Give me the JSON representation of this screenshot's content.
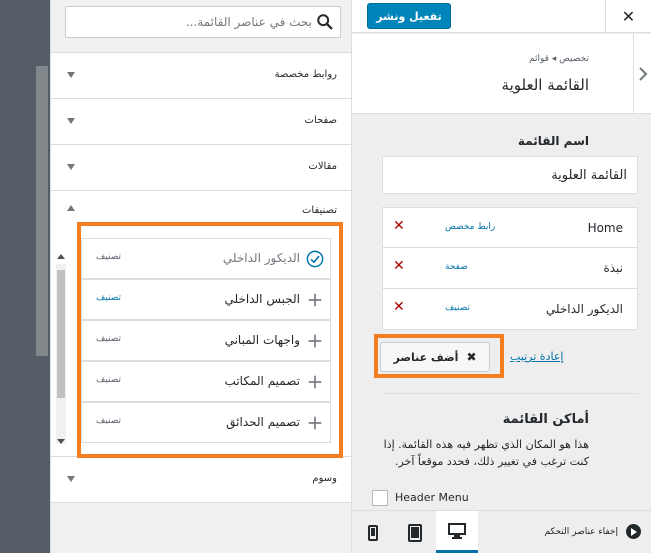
{
  "search": {
    "placeholder": "بحث في عناصر القائمة..."
  },
  "sections": [
    {
      "label": "روابط مخصصة",
      "open": false
    },
    {
      "label": "صفحات",
      "open": false
    },
    {
      "label": "مقالات",
      "open": false
    },
    {
      "label": "تصنيفات",
      "open": true
    },
    {
      "label": "وسوم",
      "open": false
    }
  ],
  "categories": [
    {
      "name": "الديكور الداخلي",
      "type": "تصنيف",
      "added": true
    },
    {
      "name": "الجبس الداخلي",
      "type": "تصنيف",
      "added": false
    },
    {
      "name": "واجهات المباني",
      "type": "تصنيف",
      "added": false
    },
    {
      "name": "تصميم المكاتب",
      "type": "تصنيف",
      "added": false
    },
    {
      "name": "تصميم الحدائق",
      "type": "تصنيف",
      "added": false
    }
  ],
  "header": {
    "publish_label": "تفعيل ونشر"
  },
  "section_head": {
    "breadcrumb": "تخصيص ◂ قوائم",
    "title": "القائمة العلوية"
  },
  "menu_name": {
    "label": "اسم القائمة",
    "value": "القائمة العلوية"
  },
  "menu_items": [
    {
      "title": "Home",
      "kind": "رابط مخصص"
    },
    {
      "title": "نبذة",
      "kind": "صفحة"
    },
    {
      "title": "الديكور الداخلي",
      "kind": "تصنيف"
    }
  ],
  "actions": {
    "add_items": "أضف عناصر",
    "reorder": "إعادة ترتيب"
  },
  "locations": {
    "title": "أماكن القائمة",
    "description": "هذا هو المكان الذي تظهر فيه هذه القائمة. إذا كنت ترغب في تغيير ذلك، فحدد موقعاً آخر.",
    "header_menu": {
      "label": "Header Menu",
      "checked": false
    }
  },
  "footer": {
    "collapse_label": "إخفاء عناصر التحكم"
  },
  "colors": {
    "accent": "#0085ba",
    "highlight": "#f47e20",
    "delete": "#aa0000"
  }
}
